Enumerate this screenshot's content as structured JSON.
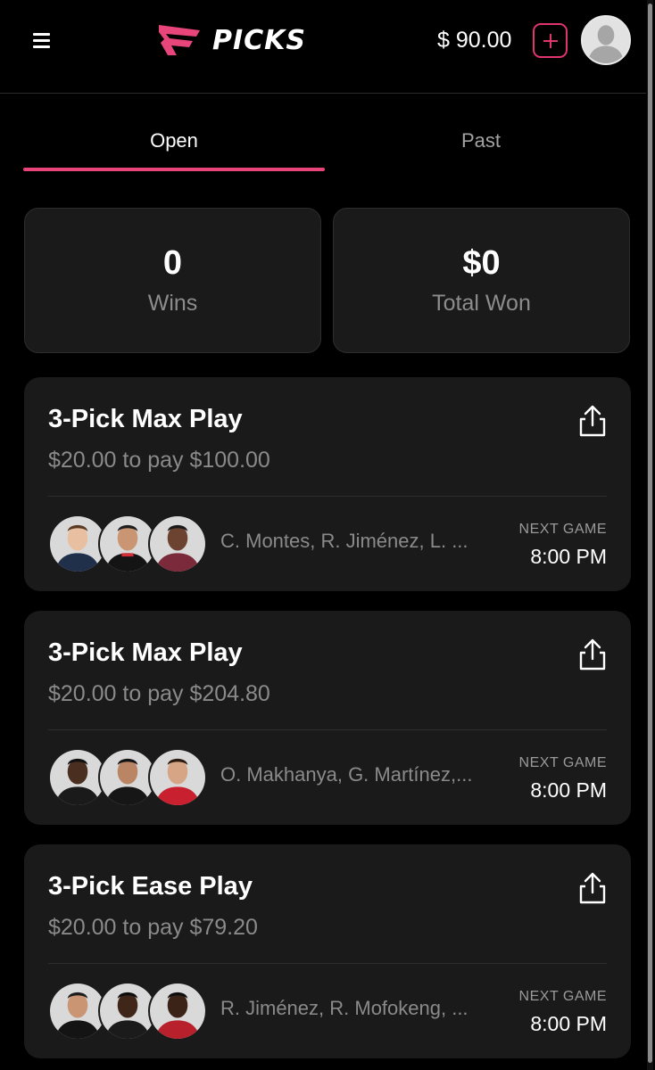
{
  "header": {
    "logo_text": "PICKS",
    "balance": "$ 90.00",
    "brand_color": "#e0356d"
  },
  "tabs": [
    {
      "label": "Open",
      "active": true
    },
    {
      "label": "Past",
      "active": false
    }
  ],
  "stats": {
    "wins_value": "0",
    "wins_label": "Wins",
    "total_won_value": "$0",
    "total_won_label": "Total Won"
  },
  "picks": [
    {
      "title": "3-Pick Max Play",
      "subtitle": "$20.00 to pay $100.00",
      "players": "C. Montes, R. Jiménez, L. ...",
      "next_label": "NEXT GAME",
      "next_time": "8:00 PM"
    },
    {
      "title": "3-Pick Max Play",
      "subtitle": "$20.00 to pay $204.80",
      "players": "O. Makhanya, G. Martínez,...",
      "next_label": "NEXT GAME",
      "next_time": "8:00 PM"
    },
    {
      "title": "3-Pick Ease Play",
      "subtitle": "$20.00 to pay $79.20",
      "players": "R. Jiménez, R. Mofokeng, ...",
      "next_label": "NEXT GAME",
      "next_time": "8:00 PM"
    }
  ]
}
